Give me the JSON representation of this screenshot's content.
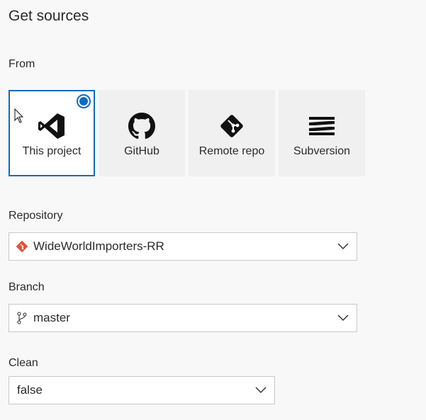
{
  "page": {
    "title": "Get sources"
  },
  "from": {
    "label": "From",
    "sources": [
      {
        "label": "This project",
        "icon": "visual-studio-icon",
        "selected": true
      },
      {
        "label": "GitHub",
        "icon": "github-icon",
        "selected": false
      },
      {
        "label": "Remote repo",
        "icon": "git-icon",
        "selected": false
      },
      {
        "label": "Subversion",
        "icon": "subversion-icon",
        "selected": false
      }
    ]
  },
  "repository": {
    "label": "Repository",
    "value": "WideWorldImporters-RR",
    "icon": "git-repo-icon"
  },
  "branch": {
    "label": "Branch",
    "value": "master",
    "icon": "branch-icon"
  },
  "clean": {
    "label": "Clean",
    "value": "false"
  },
  "colors": {
    "accent": "#0f6cbd",
    "git_orange": "#e0533b",
    "background": "#f8f8f8",
    "tile_background": "#f0f0f0"
  }
}
